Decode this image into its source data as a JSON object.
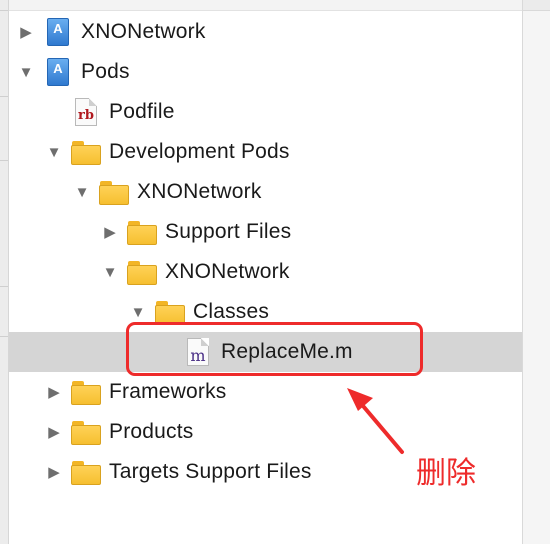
{
  "tree": {
    "items": [
      {
        "label": "XNONetwork",
        "icon": "xcode-project-icon",
        "disclosure": "collapsed"
      },
      {
        "label": "Pods",
        "icon": "xcode-project-icon",
        "disclosure": "expanded"
      },
      {
        "label": "Podfile",
        "icon": "ruby-file-icon",
        "disclosure": "none",
        "badge": "rb"
      },
      {
        "label": "Development Pods",
        "icon": "folder-icon",
        "disclosure": "expanded"
      },
      {
        "label": "XNONetwork",
        "icon": "folder-icon",
        "disclosure": "expanded"
      },
      {
        "label": "Support Files",
        "icon": "folder-icon",
        "disclosure": "collapsed"
      },
      {
        "label": "XNONetwork",
        "icon": "folder-icon",
        "disclosure": "expanded"
      },
      {
        "label": "Classes",
        "icon": "folder-icon",
        "disclosure": "expanded"
      },
      {
        "label": "ReplaceMe.m",
        "icon": "objc-file-icon",
        "disclosure": "none",
        "badge": "m",
        "selected": true
      },
      {
        "label": "Frameworks",
        "icon": "folder-icon",
        "disclosure": "collapsed"
      },
      {
        "label": "Products",
        "icon": "folder-icon",
        "disclosure": "collapsed"
      },
      {
        "label": "Targets Support Files",
        "icon": "folder-icon",
        "disclosure": "collapsed"
      }
    ]
  },
  "annotation": {
    "text": "删除",
    "color": "#ee2b2b"
  },
  "colors": {
    "selection": "#d5d5d5",
    "folder": "#f6bf30",
    "project": "#2f79cf"
  }
}
